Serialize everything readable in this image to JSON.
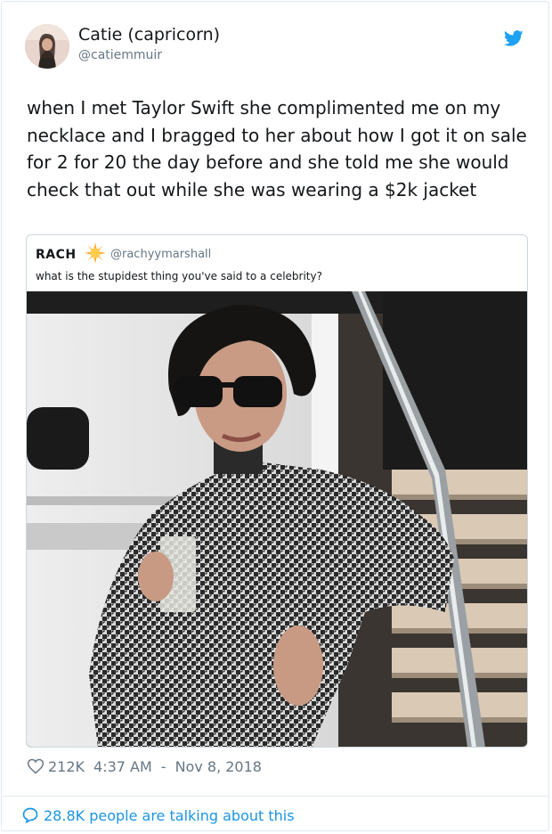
{
  "author": {
    "name": "Catie (capricorn)",
    "handle": "@catiemmuir",
    "avatar_icon": "profile-photo"
  },
  "tweet": {
    "text": "when I met Taylor Swift she complimented me on my necklace and I bragged to her about how I got it on sale for 2 for 20 the day before and she told me she would check that out while she was wearing a $2k jacket"
  },
  "quoted": {
    "name": "RACH",
    "emoji_icon": "sun-emoji",
    "handle": "@rachyymarshall",
    "text": "what is the stupidest thing you've said to a celebrity?"
  },
  "meta": {
    "likes": "212K",
    "time": "4:37 AM",
    "separator": "-",
    "date": "Nov 8, 2018"
  },
  "talking": {
    "text": "28.8K people are talking about this"
  },
  "colors": {
    "twitter_blue": "#1da1f2",
    "link_blue": "#1b95e0",
    "secondary_text": "#657786",
    "border": "#e1e8ed"
  }
}
